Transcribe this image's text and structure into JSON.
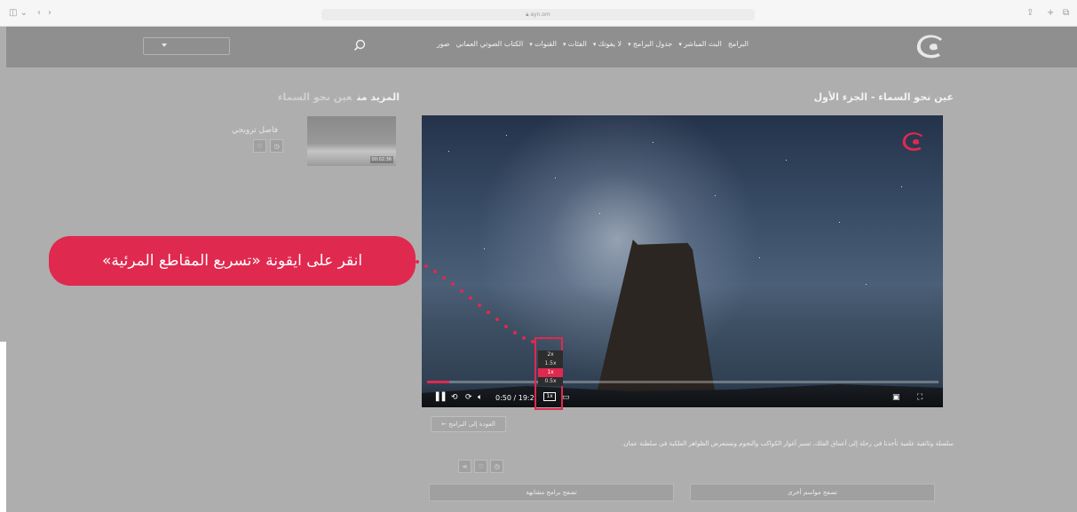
{
  "browser": {
    "url": "ayn.om",
    "window_controls_icon": "sidebar-icon",
    "actions": [
      "share-icon",
      "plus-icon",
      "tabs-icon"
    ]
  },
  "header": {
    "language_select_value": "",
    "nav_items": [
      {
        "label": "البرامج",
        "dropdown": false
      },
      {
        "label": "البث المباشر",
        "dropdown": true
      },
      {
        "label": "جدول البرامج",
        "dropdown": true
      },
      {
        "label": "لا يفوتك",
        "dropdown": true
      },
      {
        "label": "الفئات",
        "dropdown": true
      },
      {
        "label": "القنوات",
        "dropdown": true
      },
      {
        "label": "الكتاب الصوتي العماني",
        "dropdown": false
      },
      {
        "label": "صور",
        "dropdown": false
      }
    ]
  },
  "main": {
    "title": "عين نحو السماء - الجزء الأول",
    "description": "سلسلة وثائقية علمية تأخذنا في رحلة إلى أعماق الفلك، تسبر أغوار الكواكب والنجوم وتستعرض الظواهر الفلكية في سلطنة عمان.",
    "back_button": "العودة إلى البرامج ←",
    "browse_seasons": "تصفح مواسم أخرى",
    "browse_similar": "تصفح برامج مشابهة"
  },
  "player": {
    "current_time": "0:50",
    "duration": "19:2",
    "progress_fraction": 0.043,
    "speed_options": [
      "2x",
      "1.5x",
      "1x",
      "0.5x"
    ],
    "selected_speed": "1x",
    "speed_button_label": "1x"
  },
  "sidebar": {
    "title_prefix": "المزيد من",
    "title_program": "عين نحو السماء",
    "item": {
      "title": "فاصل ترويجي",
      "duration": "00:02:36"
    }
  },
  "overlay": {
    "instruction": "انقر على ايقونة «تسريع المقاطع المرئية»"
  },
  "colors": {
    "accent": "#e0294f",
    "overlay_gray": "#aeaeae"
  }
}
